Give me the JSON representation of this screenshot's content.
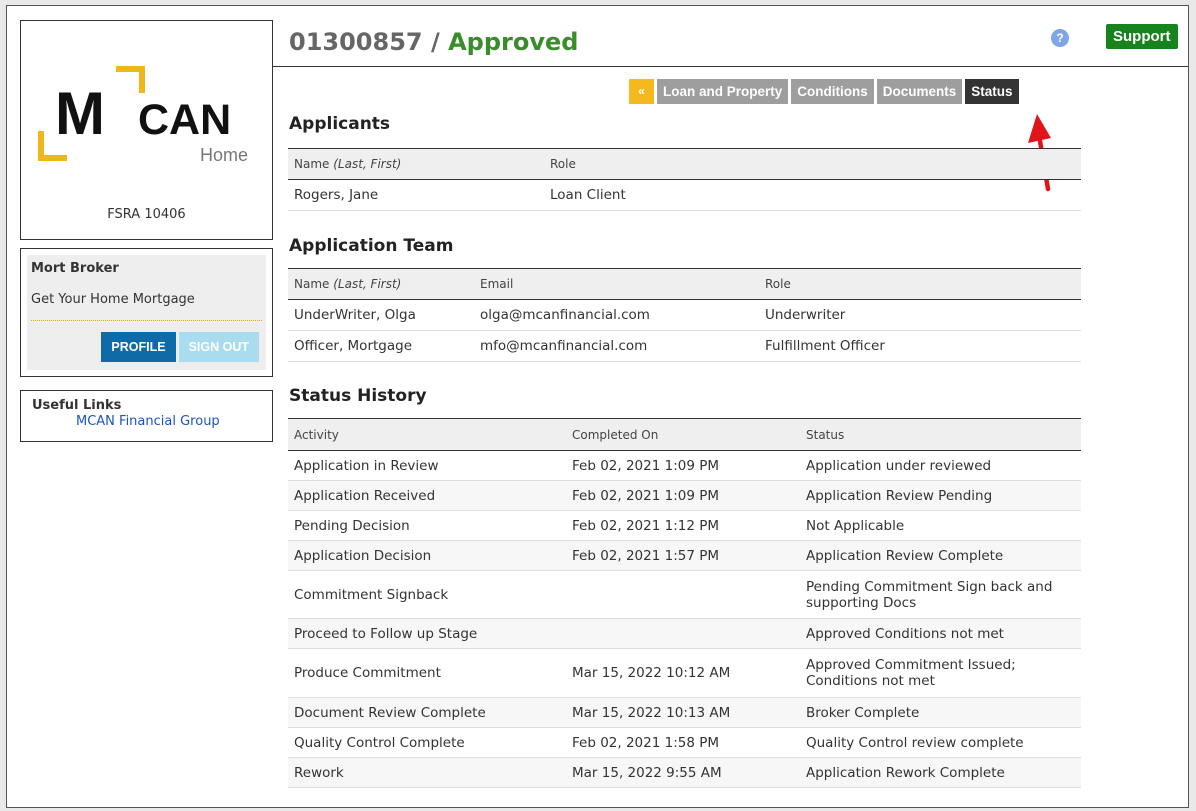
{
  "header": {
    "loan_number": "01300857",
    "separator": " / ",
    "status": "Approved",
    "support_label": "Support",
    "help_icon": "question-circle-icon"
  },
  "sidebar": {
    "logo_text_m": "M",
    "logo_text_can": "CAN",
    "logo_text_home": "Home",
    "fsra": "FSRA 10406",
    "broker_name": "Mort Broker",
    "broker_tagline": "Get Your Home Mortgage",
    "profile_label": "PROFILE",
    "signout_label": "SIGN OUT",
    "links_title": "Useful Links",
    "links": [
      {
        "label": "MCAN Financial Group"
      }
    ]
  },
  "tabs": [
    {
      "label": "«"
    },
    {
      "label": "Loan and Property"
    },
    {
      "label": "Conditions"
    },
    {
      "label": "Documents"
    },
    {
      "label": "Status",
      "active": true
    }
  ],
  "applicants": {
    "title": "Applicants",
    "headers": [
      "Name",
      "(Last, First)",
      "Role"
    ],
    "rows": [
      {
        "name": "Rogers, Jane",
        "role": "Loan Client"
      }
    ]
  },
  "team": {
    "title": "Application Team",
    "headers": [
      "Name",
      "(Last, First)",
      "Email",
      "Role"
    ],
    "rows": [
      {
        "name": "UnderWriter, Olga",
        "email": "olga@mcanfinancial.com",
        "role": "Underwriter"
      },
      {
        "name": "Officer, Mortgage",
        "email": "mfo@mcanfinancial.com",
        "role": "Fulfillment Officer"
      }
    ]
  },
  "history": {
    "title": "Status History",
    "headers": [
      "Activity",
      "Completed On",
      "Status"
    ],
    "rows": [
      {
        "activity": "Application in Review",
        "completed": "Feb 02, 2021 1:09 PM",
        "status": "Application under reviewed"
      },
      {
        "activity": "Application Received",
        "completed": "Feb 02, 2021 1:09 PM",
        "status": "Application Review Pending"
      },
      {
        "activity": "Pending Decision",
        "completed": "Feb 02, 2021 1:12 PM",
        "status": "Not Applicable"
      },
      {
        "activity": "Application Decision",
        "completed": "Feb 02, 2021 1:57 PM",
        "status": "Application Review Complete"
      },
      {
        "activity": "Commitment Signback",
        "completed": "",
        "status": "Pending Commitment Sign back and supporting Docs"
      },
      {
        "activity": "Proceed to Follow up Stage",
        "completed": "",
        "status": "Approved Conditions not met"
      },
      {
        "activity": "Produce Commitment",
        "completed": "Mar 15, 2022 10:12 AM",
        "status": "Approved Commitment Issued; Conditions not met"
      },
      {
        "activity": "Document Review Complete",
        "completed": "Mar 15, 2022 10:13 AM",
        "status": "Broker Complete"
      },
      {
        "activity": "Quality Control Complete",
        "completed": "Feb 02, 2021 1:58 PM",
        "status": "Quality Control review complete"
      },
      {
        "activity": "Rework",
        "completed": "Mar 15, 2022 9:55 AM",
        "status": "Application Rework Complete"
      }
    ]
  },
  "colors": {
    "approved": "#3b8c2a",
    "support": "#17831d",
    "profile": "#0e6ba8",
    "signout": "#a9dcef",
    "tab_back": "#f3b91d",
    "tab": "#9e9e9e",
    "tab_active": "#333333",
    "arrow": "#e0141b",
    "link": "#1a55c4",
    "logo_accent": "#f2b51c"
  }
}
